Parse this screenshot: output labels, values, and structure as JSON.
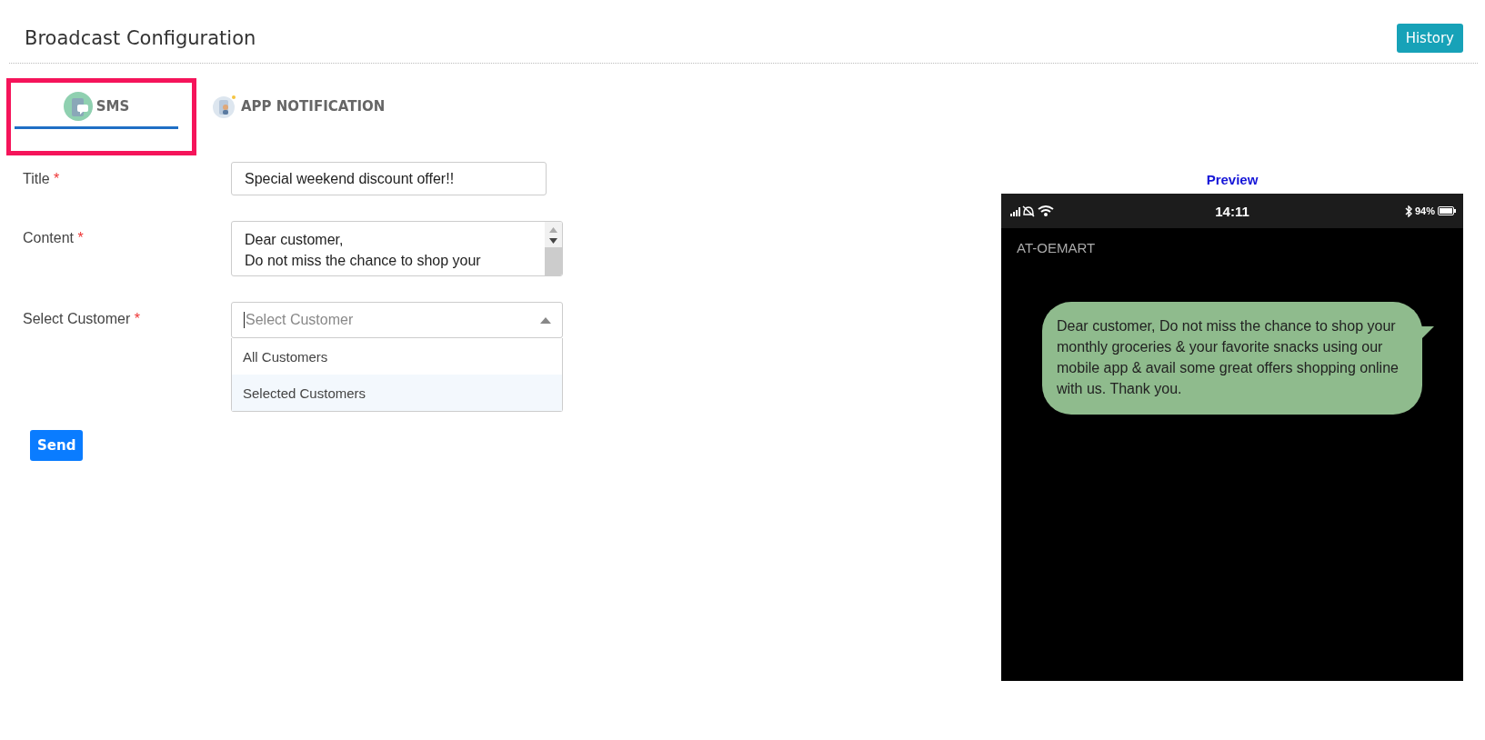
{
  "header": {
    "title": "Broadcast Configuration",
    "history_button": "History"
  },
  "tabs": [
    {
      "label": "SMS",
      "kind": "sms",
      "selected": true,
      "outlined": true
    },
    {
      "label": "APP NOTIFICATION",
      "kind": "app",
      "selected": false,
      "outlined": false
    }
  ],
  "form": {
    "fields": [
      {
        "kind": "input",
        "label": "Title",
        "required": "*",
        "value": "Special weekend discount offer!!"
      },
      {
        "kind": "textarea",
        "label": "Content",
        "required": "*",
        "value": "Dear customer,\nDo not miss the chance to shop your"
      },
      {
        "kind": "select",
        "label": "Select Customer",
        "required": "*",
        "placeholder": "Select Customer",
        "expanded": true,
        "options": [
          {
            "label": "All Customers",
            "selected": false
          },
          {
            "label": "Selected Customers",
            "selected": true
          }
        ]
      }
    ],
    "send_button": "Send"
  },
  "preview": {
    "heading": "Preview",
    "time": "14:11",
    "battery": "94%",
    "sender": "AT-OEMART",
    "message": "Dear customer, Do not miss the chance to shop your monthly groceries & your favorite snacks using our mobile app & avail some great offers shopping online with us. Thank you."
  }
}
